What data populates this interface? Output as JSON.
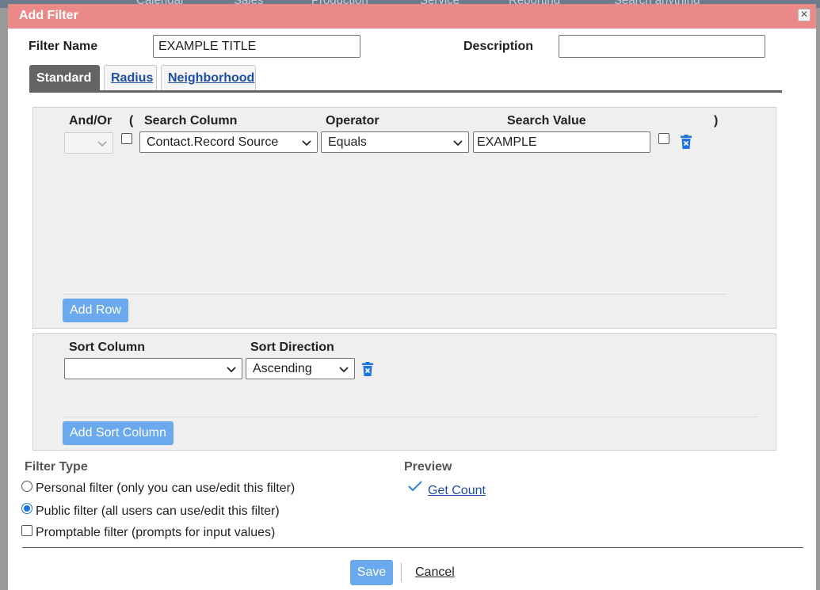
{
  "background_nav": [
    "Calendar",
    "Sales",
    "Production",
    "Service",
    "Reporting",
    "Search anything"
  ],
  "dialog": {
    "title": "Add Filter",
    "close_icon": "close-icon"
  },
  "filter_name": {
    "label": "Filter Name",
    "value": "EXAMPLE TITLE"
  },
  "description": {
    "label": "Description",
    "value": ""
  },
  "tabs": [
    {
      "label": "Standard",
      "active": true
    },
    {
      "label": "Radius",
      "active": false
    },
    {
      "label": "Neighborhood",
      "active": false
    }
  ],
  "criteria": {
    "headers": {
      "and_or": "And/Or",
      "open_paren": "(",
      "search_column": "Search Column",
      "operator": "Operator",
      "search_value": "Search Value",
      "close_paren": ")"
    },
    "rows": [
      {
        "and_or": "",
        "search_column": "Contact.Record Source",
        "operator": "Equals",
        "search_value": "EXAMPLE"
      }
    ],
    "add_row_label": "Add Row"
  },
  "sort": {
    "headers": {
      "sort_column": "Sort Column",
      "sort_direction": "Sort Direction"
    },
    "rows": [
      {
        "sort_column": "",
        "sort_direction": "Ascending"
      }
    ],
    "add_sort_label": "Add Sort Column"
  },
  "filter_type": {
    "label": "Filter Type",
    "options": [
      {
        "label": "Personal filter (only you can use/edit this filter)",
        "selected": false
      },
      {
        "label": "Public filter (all users can use/edit this filter)",
        "selected": true
      }
    ],
    "promptable_label": "Promptable filter (prompts for input values)",
    "promptable_checked": false
  },
  "preview": {
    "label": "Preview",
    "get_count_label": "Get Count"
  },
  "footer": {
    "save_label": "Save",
    "cancel_label": "Cancel"
  },
  "colors": {
    "title_bar": "#e98a88",
    "primary_button": "#6ba9ee",
    "active_tab": "#646464",
    "link": "#1e4fa8",
    "trash_icon": "#1a73e8"
  }
}
